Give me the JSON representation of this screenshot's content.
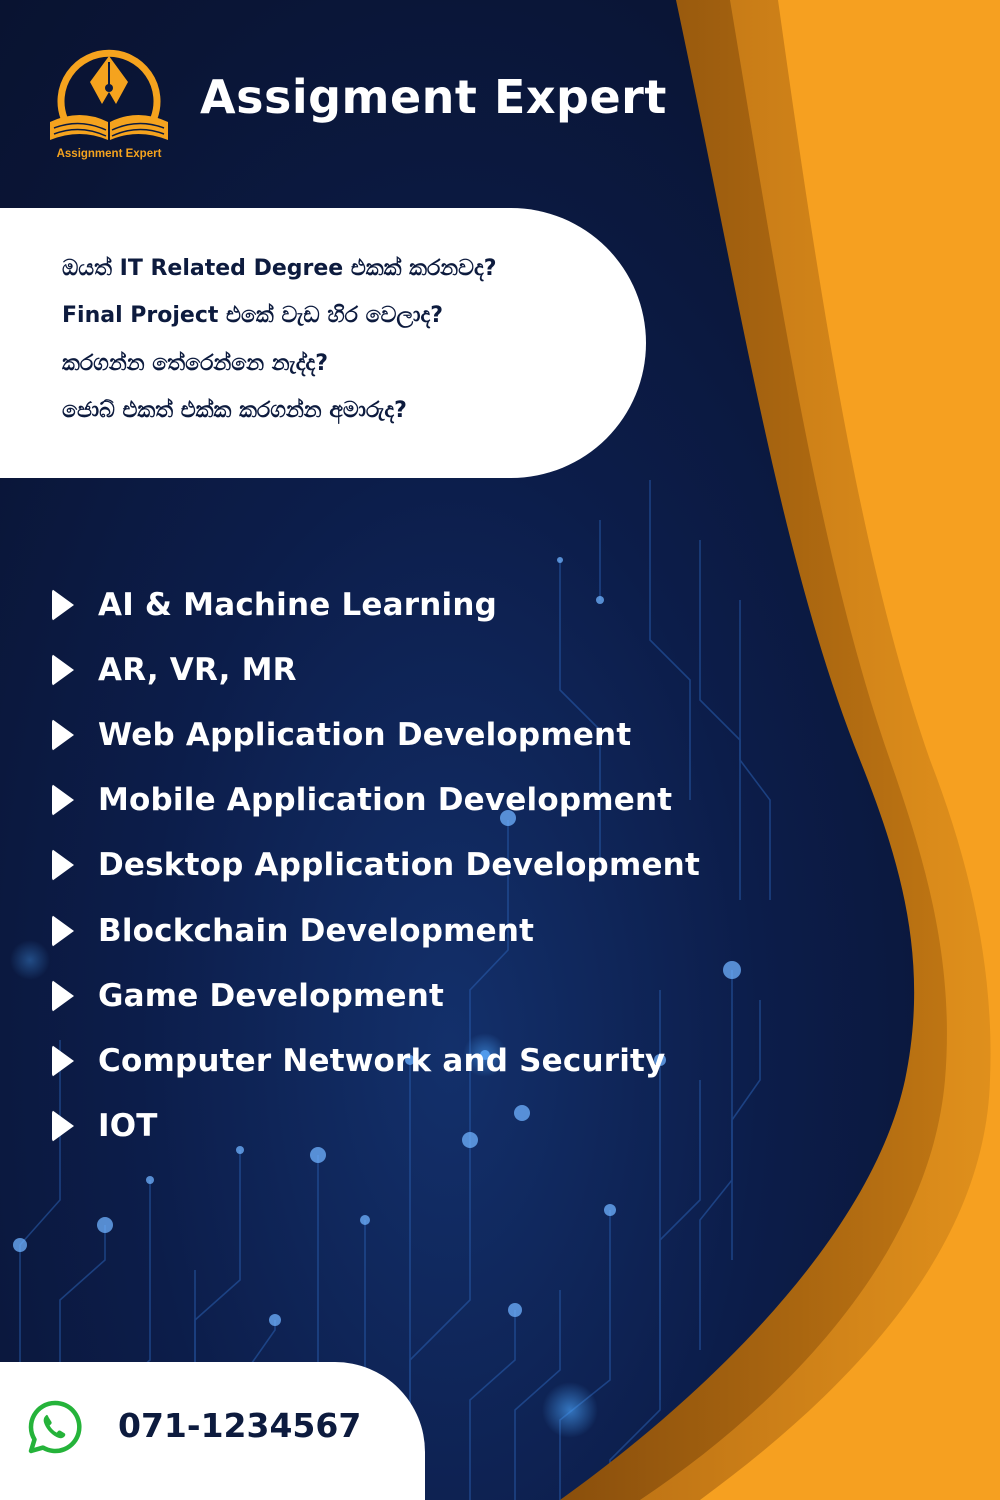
{
  "brand": {
    "title": "Assigment Expert",
    "logo_text": "Assignment Expert",
    "logo_icon": "open-book-pen-nib-icon"
  },
  "questions": [
    "ඔයත් IT Related Degree එකක් කරනවද?",
    "Final Project එකේ වැඩ හිර වෙලාද?",
    "කරගන්න තේරෙන්නෙ නැද්ද?",
    "ජොබ් එකත් එක්ක කරගන්න අමාරුද?"
  ],
  "services": [
    "AI & Machine Learning",
    "AR, VR, MR",
    "Web Application Development",
    "Mobile Application Development",
    "Desktop Application Development",
    "Blockchain Development",
    "Game Development",
    "Computer Network and Security",
    "IOT"
  ],
  "contact": {
    "icon": "whatsapp-icon",
    "phone": "071-1234567"
  },
  "colors": {
    "navy_background": "#0b1a40",
    "orange_accent": "#f6a020",
    "orange_dark": "#b56a10",
    "text_dark": "#0d1b3e",
    "white": "#ffffff"
  }
}
